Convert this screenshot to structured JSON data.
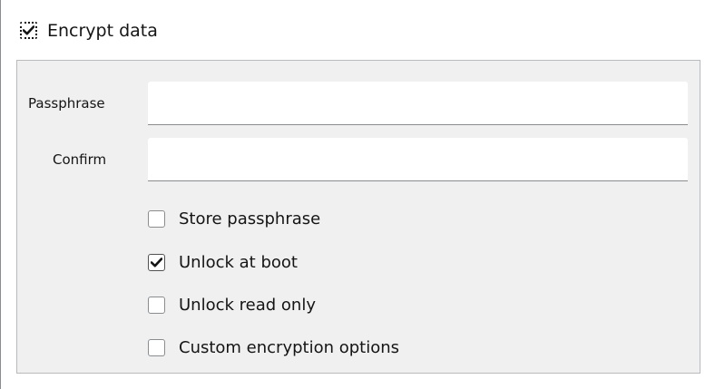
{
  "encrypt": {
    "label": "Encrypt data",
    "checked": true
  },
  "fields": {
    "passphrase": {
      "label": "Passphrase",
      "value": "",
      "placeholder": ""
    },
    "confirm": {
      "label": "Confirm",
      "value": "",
      "placeholder": ""
    }
  },
  "options": [
    {
      "label": "Store passphrase",
      "checked": false
    },
    {
      "label": "Unlock at boot",
      "checked": true
    },
    {
      "label": "Unlock read only",
      "checked": false
    },
    {
      "label": "Custom encryption options",
      "checked": false
    }
  ],
  "colors": {
    "panel_background": "#f0f0f0",
    "panel_border": "#b8bbbe",
    "text": "#151515",
    "field_underline": "#8a8d90"
  },
  "icons": {
    "checked": "checkmark-icon"
  }
}
